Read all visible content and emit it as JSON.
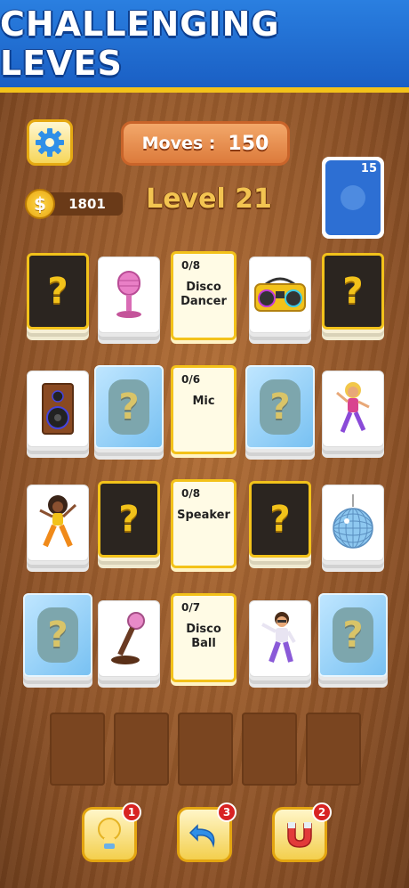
{
  "banner": {
    "title": "CHALLENGING LEVES"
  },
  "hud": {
    "moves_label": "Moves :",
    "moves_value": "150",
    "coins": "1801",
    "coin_symbol": "$",
    "level": "Level 21",
    "deck_count": "15"
  },
  "goals": [
    {
      "count": "0/8",
      "label": "Disco\nDancer"
    },
    {
      "count": "0/6",
      "label": "Mic"
    },
    {
      "count": "0/8",
      "label": "Speaker"
    },
    {
      "count": "0/7",
      "label": "Disco\nBall"
    }
  ],
  "mystery_symbol": "?",
  "boosters": [
    {
      "name": "hint",
      "icon": "lightbulb-icon",
      "count": "1"
    },
    {
      "name": "undo",
      "icon": "undo-arrow-icon",
      "count": "3"
    },
    {
      "name": "magnet",
      "icon": "magnet-icon",
      "count": "2"
    }
  ],
  "colors": {
    "accent": "#f3c21a",
    "banner": "#1f6fd8",
    "wood": "#a4622f"
  }
}
